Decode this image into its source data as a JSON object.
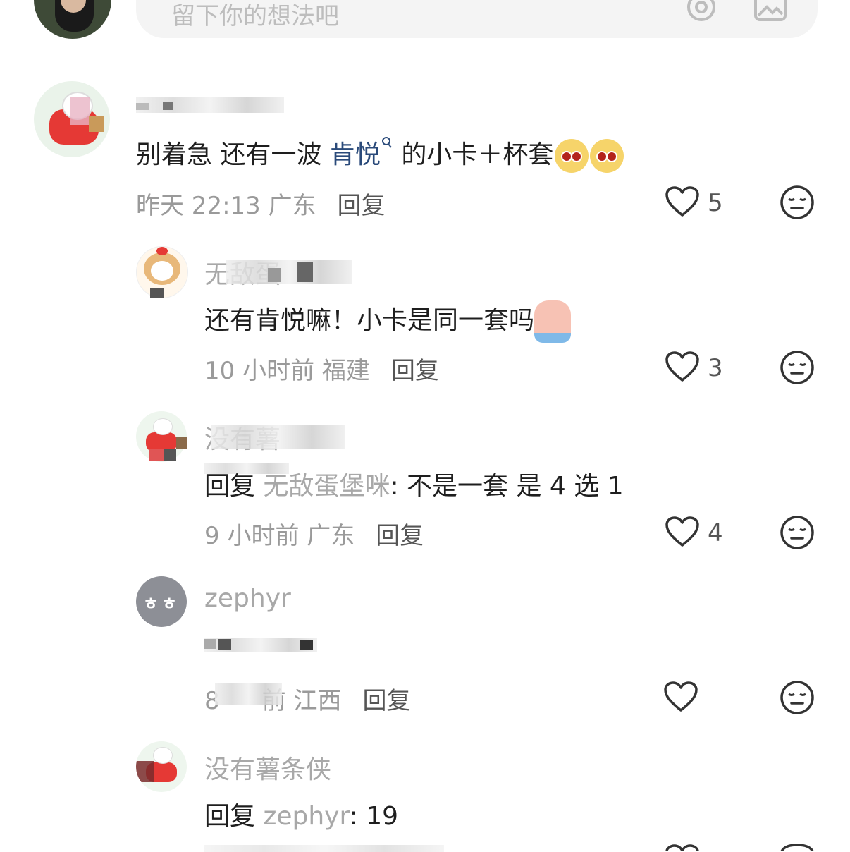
{
  "input": {
    "placeholder": "留下你的想法吧"
  },
  "comments": [
    {
      "name": "",
      "text_before": "别着急   还有一波 ",
      "link": "肯悦",
      "text_after": " 的小卡＋杯套",
      "time": "昨天 22:13 广东",
      "reply_label": "回复",
      "likes": "5"
    },
    {
      "name": "无敌蛋",
      "text": "还有肯悦嘛！小卡是同一套吗",
      "time": "10 小时前 福建",
      "reply_label": "回复",
      "likes": "3"
    },
    {
      "name": "没有薯",
      "reply_prefix": "回复 ",
      "reply_to": "无敌蛋堡咪",
      "text": ": 不是一套  是 4 选 1",
      "time": "9 小时前 广东",
      "reply_label": "回复",
      "likes": "4"
    },
    {
      "name": "zephyr",
      "avatar_text": "ㅎㅎ",
      "text": "",
      "time": "前 江西",
      "time_prefix": "8",
      "reply_label": "回复",
      "likes": ""
    },
    {
      "name": "没有薯条侠",
      "reply_prefix": "回复 ",
      "reply_to": "zephyr",
      "text": ": 19"
    }
  ],
  "icons": {
    "heart": "heart-outline-icon",
    "dislike": "meh-face-icon",
    "at": "at-sign-icon",
    "image": "image-icon"
  },
  "colors": {
    "link": "#2a4a7a",
    "muted": "#9a9a9a",
    "input_bg": "#f4f4f4"
  }
}
